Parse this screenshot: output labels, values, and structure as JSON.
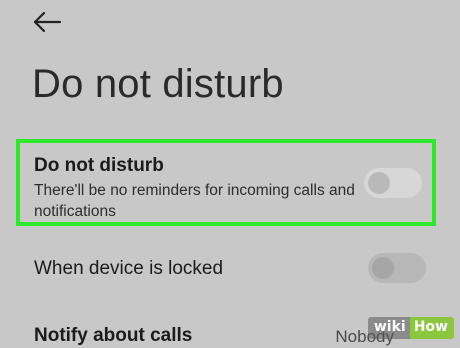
{
  "header": {
    "back_icon": "back-arrow-icon",
    "title": "Do not disturb"
  },
  "settings": {
    "dnd": {
      "label": "Do not disturb",
      "description": "There'll be no reminders for incoming calls and notifications",
      "enabled": false,
      "highlight_color": "#2ee82e"
    },
    "when_locked": {
      "label": "When device is locked",
      "enabled": false
    },
    "notify_calls": {
      "label": "Notify about calls",
      "value": "Nobody"
    }
  },
  "watermark": {
    "part1": "wiki",
    "part2": "How"
  }
}
